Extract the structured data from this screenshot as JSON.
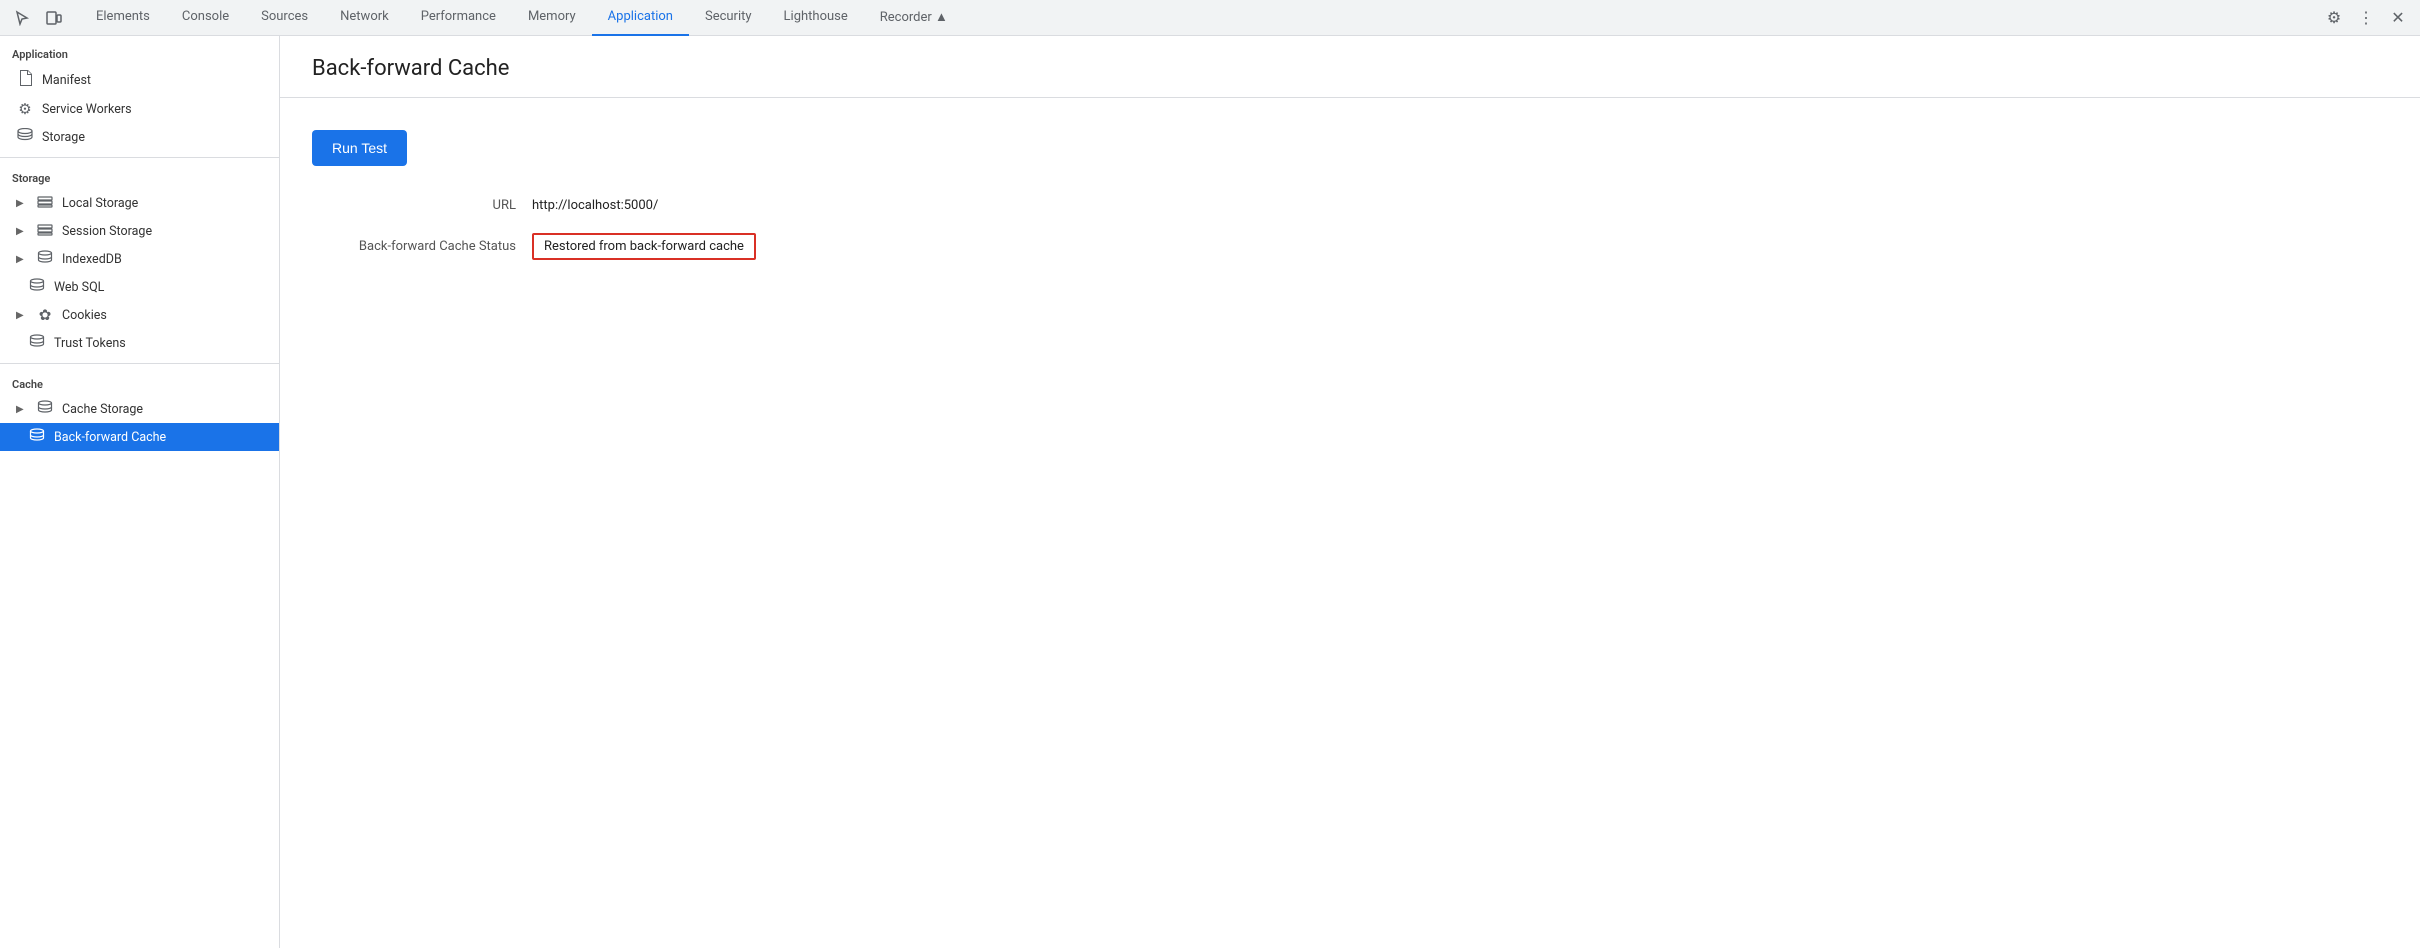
{
  "tabs": {
    "items": [
      {
        "label": "Elements",
        "active": false
      },
      {
        "label": "Console",
        "active": false
      },
      {
        "label": "Sources",
        "active": false
      },
      {
        "label": "Network",
        "active": false
      },
      {
        "label": "Performance",
        "active": false
      },
      {
        "label": "Memory",
        "active": false
      },
      {
        "label": "Application",
        "active": true
      },
      {
        "label": "Security",
        "active": false
      },
      {
        "label": "Lighthouse",
        "active": false
      },
      {
        "label": "Recorder ▲",
        "active": false
      }
    ]
  },
  "sidebar": {
    "application_label": "Application",
    "storage_label": "Storage",
    "cache_label": "Cache",
    "items": {
      "manifest": "Manifest",
      "service_workers": "Service Workers",
      "storage": "Storage",
      "local_storage": "Local Storage",
      "session_storage": "Session Storage",
      "indexeddb": "IndexedDB",
      "web_sql": "Web SQL",
      "cookies": "Cookies",
      "trust_tokens": "Trust Tokens",
      "cache_storage": "Cache Storage",
      "back_forward_cache": "Back-forward Cache"
    }
  },
  "content": {
    "title": "Back-forward Cache",
    "run_test_label": "Run Test",
    "url_label": "URL",
    "url_value": "http://localhost:5000/",
    "status_label": "Back-forward Cache Status",
    "status_value": "Restored from back-forward cache"
  },
  "colors": {
    "active_tab": "#1a73e8",
    "active_sidebar": "#1a73e8",
    "status_border": "#d93025",
    "run_btn": "#1a73e8"
  }
}
